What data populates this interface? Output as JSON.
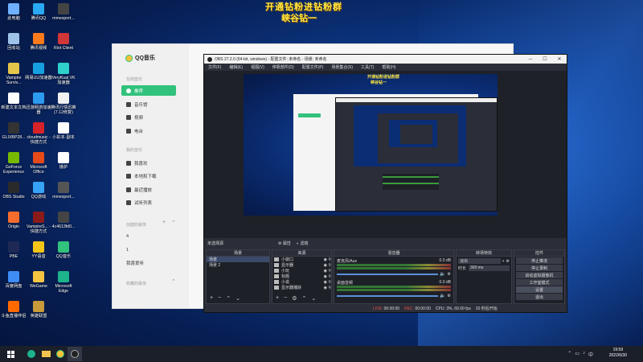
{
  "overlay": {
    "title": "开通钻粉进钻粉群",
    "subtitle": "峡谷钻一"
  },
  "desktop_icons": [
    {
      "label": "此电脑",
      "color": "#6fb1ff"
    },
    {
      "label": "腾讯QQ",
      "color": "#2aa8f2"
    },
    {
      "label": "mmexport...",
      "color": "#444"
    },
    {
      "label": "回收站",
      "color": "#9fc3e8"
    },
    {
      "label": "腾讯视频",
      "color": "#ff7a1a"
    },
    {
      "label": "Riot Client",
      "color": "#d13639"
    },
    {
      "label": "Vampire Surviv...",
      "color": "#e6c64a"
    },
    {
      "label": "网易UU加速器",
      "color": "#17a0e0"
    },
    {
      "label": "VeryKuai VK加速器",
      "color": "#2fd0c9"
    },
    {
      "label": "新建文本文档",
      "color": "#ffffff"
    },
    {
      "label": "迅游网游加速器",
      "color": "#2d9bf0"
    },
    {
      "label": "腾讯行情迅推(7.12修复)",
      "color": "#f0f0f0"
    },
    {
      "label": "GLIXBP28...",
      "color": "#333"
    },
    {
      "label": "cloudmusic - 快捷方式",
      "color": "#d8232a"
    },
    {
      "label": "小彩本·副本",
      "color": "#ffffff"
    },
    {
      "label": "GeForce Experience",
      "color": "#76b900"
    },
    {
      "label": "Microsoft Office",
      "color": "#e64a19"
    },
    {
      "label": "播护",
      "color": "#ffffff"
    },
    {
      "label": "OBS Studio",
      "color": "#2a2a2a"
    },
    {
      "label": "QQ游戏",
      "color": "#36a3f7"
    },
    {
      "label": "mmexport...",
      "color": "#555"
    },
    {
      "label": "Origin",
      "color": "#f56c2d"
    },
    {
      "label": "VampireS... - 快捷方式",
      "color": "#8b1a1a"
    },
    {
      "label": "4c4613fd0...",
      "color": "#444"
    },
    {
      "label": "PBE",
      "color": "#1e2a55"
    },
    {
      "label": "YY语音",
      "color": "#f5c518"
    },
    {
      "label": "QQ音乐",
      "color": "#31c27c"
    },
    {
      "label": "百度网盘",
      "color": "#3f8cf4"
    },
    {
      "label": "WeGame",
      "color": "#f5c542"
    },
    {
      "label": "Microsoft Edge",
      "color": "#1db38a"
    },
    {
      "label": "斗鱼直播伴侣",
      "color": "#ff6a00"
    },
    {
      "label": "英雄联盟",
      "color": "#c79a3a"
    }
  ],
  "qq_music": {
    "logo": "QQ音乐",
    "section_online": "在线音乐",
    "items_online": [
      "推荐",
      "音乐馆",
      "视频",
      "电台"
    ],
    "section_mine": "我的音乐",
    "items_mine": [
      "我喜欢",
      "本地和下载",
      "最近播放",
      "试听列表"
    ],
    "section_created": "创建的歌单",
    "plus": "+",
    "created_nums": [
      "4",
      "1"
    ],
    "created_label": "我喜爱听",
    "section_collected": "收藏的歌单"
  },
  "obs": {
    "title": "OBS 27.2.0 (64-bit, windows) - 配置文件: 未命名 - 场景: 未命名",
    "minimize": "─",
    "maximize": "☐",
    "close": "✕",
    "menu": [
      "文件(F)",
      "编辑(E)",
      "视图(V)",
      "停靠部件(D)",
      "配置文件(P)",
      "场景集合(S)",
      "工具(T)",
      "帮助(H)"
    ],
    "no_source": "未选择源",
    "properties": "属性",
    "filters": "滤镜",
    "panels": {
      "scenes": {
        "title": "场景",
        "items": [
          "场景",
          "场景 2"
        ]
      },
      "sources": {
        "title": "来源",
        "items": [
          "小窗口",
          "显示器",
          "小玩",
          "标题",
          "小说",
          "显示器捕获"
        ]
      },
      "mixer": {
        "title": "混音器",
        "tracks": [
          {
            "name": "麦克风/Aux",
            "db": "0.0 dB"
          },
          {
            "name": "桌面音频",
            "db": "0.0 dB"
          }
        ]
      },
      "transitions": {
        "title": "转场特效",
        "fade": "淡出",
        "duration_label": "时长",
        "duration": "300 ms"
      },
      "controls": {
        "title": "控件",
        "buttons": [
          "停止推流",
          "停止录制",
          "启动虚拟摄像机",
          "工作室模式",
          "设置",
          "退出"
        ]
      }
    },
    "status": {
      "live_label": "LIVE:",
      "live_time": "00:00:00",
      "rec_label": "REC:",
      "rec_time": "00:00:00",
      "cpu": "CPU: 3%, 60.00 fps",
      "bitrate": "20 秒后开始"
    }
  },
  "taskbar": {
    "time": "19:59",
    "date": "2022/6/30"
  }
}
